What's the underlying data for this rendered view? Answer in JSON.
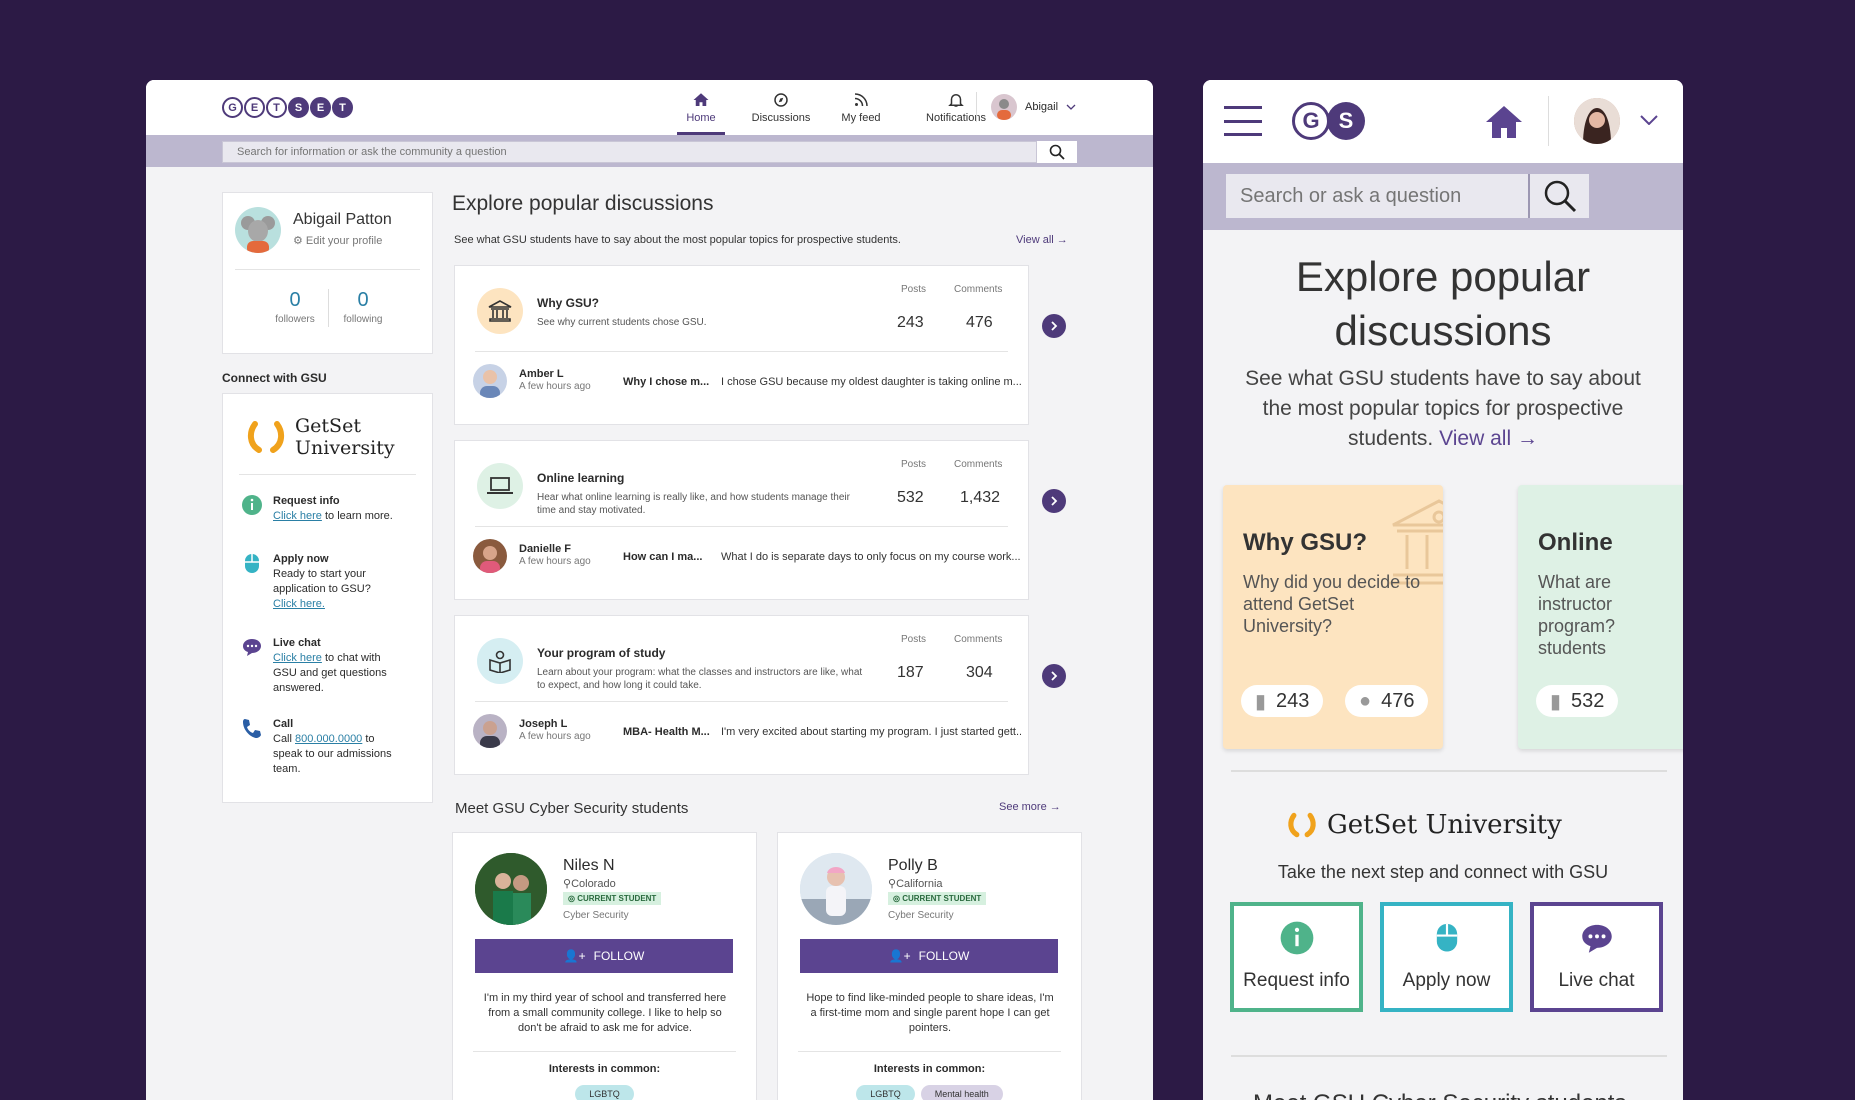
{
  "desktop": {
    "logo_letters": [
      "G",
      "E",
      "T",
      "S",
      "E",
      "T"
    ],
    "nav": [
      {
        "label": "Home",
        "icon": "home-icon"
      },
      {
        "label": "Discussions",
        "icon": "compass-icon"
      },
      {
        "label": "My feed",
        "icon": "rss-icon"
      },
      {
        "label": "Notifications",
        "icon": "bell-icon"
      }
    ],
    "user_name": "Abigail",
    "search_placeholder": "Search for information or ask the community a question",
    "profile": {
      "name": "Abigail Patton",
      "edit": "Edit your profile",
      "followers_count": "0",
      "followers_label": "followers",
      "following_count": "0",
      "following_label": "following"
    },
    "connect": {
      "heading": "Connect with GSU",
      "uni_line1": "GetSet",
      "uni_line2": "University",
      "request_title": "Request info",
      "request_link": "Click here",
      "request_text": " to learn more.",
      "apply_title": "Apply now",
      "apply_text": "Ready to start your application to GSU?",
      "apply_link": "Click here.",
      "chat_title": "Live chat",
      "chat_link": "Click here",
      "chat_text": " to chat with GSU and get questions answered.",
      "call_title": "Call",
      "call_pre": "Call ",
      "call_number": "800.000.0000",
      "call_text": " to speak to our admissions team."
    },
    "main": {
      "heading": "Explore popular discussions",
      "subheading": "See what GSU students have to say about the most popular topics for prospective students.",
      "view_all": "View all",
      "posts_label": "Posts",
      "comments_label": "Comments",
      "discussions": [
        {
          "title": "Why GSU?",
          "desc": "See why current students chose GSU.",
          "posts": "243",
          "comments": "476",
          "author": "Amber L",
          "time": "A few hours ago",
          "subject": "Why I chose m...",
          "preview": "I chose GSU because my oldest daughter is taking online m..."
        },
        {
          "title": "Online learning",
          "desc": "Hear what online learning is really like, and how students manage their time and stay motivated.",
          "posts": "532",
          "comments": "1,432",
          "author": "Danielle F",
          "time": "A few hours ago",
          "subject": "How can I ma...",
          "preview": "What I do is separate days to only focus on my course work..."
        },
        {
          "title": "Your program of study",
          "desc": "Learn about your program: what the classes and instructors are like, what to expect, and how long it could take.",
          "posts": "187",
          "comments": "304",
          "author": "Joseph L",
          "time": "A few hours ago",
          "subject": "MBA- Health M...",
          "preview": "I'm very excited about starting my program.  I just started gett..."
        }
      ],
      "meet_heading": "Meet GSU Cyber Security students",
      "see_more": "See more",
      "follow_label": "FOLLOW",
      "badge_label": "CURRENT STUDENT",
      "interests_label": "Interests in common:",
      "students": [
        {
          "name": "Niles N",
          "location": "Colorado",
          "major": "Cyber Security",
          "bio": "I'm in my third year of school and transferred here from a small community college. I like to help so don't be afraid to ask me for advice.",
          "tags": [
            "LGBTQ"
          ]
        },
        {
          "name": "Polly B",
          "location": "California",
          "major": "Cyber Security",
          "bio": "Hope to find like-minded people to share ideas, I'm a first-time mom and single parent hope I can get pointers.",
          "tags": [
            "LGBTQ",
            "Mental health"
          ]
        }
      ]
    }
  },
  "mobile": {
    "logo_g": "G",
    "logo_s": "S",
    "search_placeholder": "Search or ask a question",
    "heading": "Explore popular discussions",
    "subheading": "See what GSU students have to say about the most popular topics for prospective students.",
    "view_all": "View all",
    "tile1": {
      "title": "Why GSU?",
      "desc": "Why did you decide to attend GetSet University?",
      "posts": "243",
      "comments": "476",
      "color": "#fde4c0"
    },
    "tile2": {
      "title": "Online",
      "desc": "What are instructor program? students",
      "posts": "532",
      "color": "#def1e5"
    },
    "uni": "GetSet University",
    "connect_text": "Take the next step and connect with GSU",
    "buttons": [
      {
        "label": "Request info",
        "color": "#4fb38a"
      },
      {
        "label": "Apply now",
        "color": "#35b3c4"
      },
      {
        "label": "Live chat",
        "color": "#5b4490"
      }
    ],
    "next_heading": "Meet GSU Cyber Security students"
  },
  "colors": {
    "brand": "#4e3a7a",
    "background": "#2c1a45",
    "link": "#2a7fa5"
  }
}
